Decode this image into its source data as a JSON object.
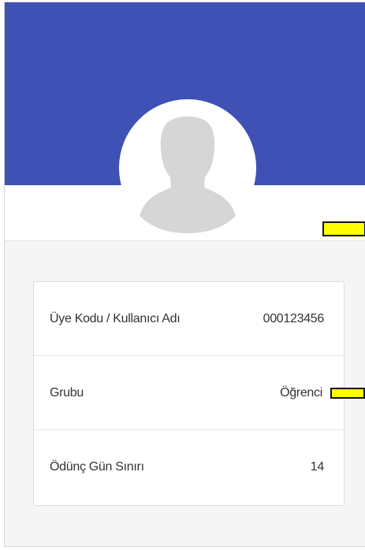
{
  "profile": {
    "avatar_icon": "default-user-silhouette-icon",
    "colors": {
      "cover": "#3f51b5",
      "marker": "#ffff00"
    }
  },
  "details": {
    "rows": [
      {
        "label": "Üye Kodu / Kullanıcı Adı",
        "value": "000123456"
      },
      {
        "label": "Grubu",
        "value": "Öğrenci"
      },
      {
        "label": "Ödünç Gün Sınırı",
        "value": "14"
      }
    ]
  }
}
